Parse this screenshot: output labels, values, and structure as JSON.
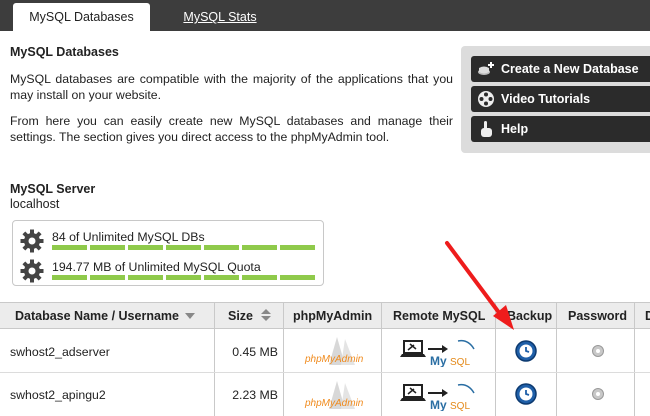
{
  "tabs": [
    {
      "label": "MySQL Databases",
      "active": true
    },
    {
      "label": "MySQL Stats",
      "active": false
    }
  ],
  "page": {
    "title": "MySQL Databases",
    "intro_1": "MySQL databases are compatible with the majority of the applications that you may install on your website.",
    "intro_2": "From here you can easily create new MySQL databases and manage their settings. The section gives you direct access to the phpMyAdmin tool."
  },
  "actions": {
    "create_label": "Create a New Database",
    "video_label": "Video Tutorials",
    "help_label": "Help"
  },
  "server": {
    "title": "MySQL Server",
    "host": "localhost"
  },
  "quota": {
    "dbs_text": "84 of Unlimited MySQL DBs",
    "size_text": "194.77 MB of Unlimited MySQL Quota"
  },
  "table": {
    "headers": {
      "name": "Database Name / Username",
      "size": "Size",
      "phpmyadmin": "phpMyAdmin",
      "remote": "Remote MySQL",
      "backup": "Backup",
      "password": "Password"
    },
    "rows": [
      {
        "name": "swhost2_adserver",
        "size": "0.45 MB",
        "phpmyadmin_logo": "phpMyAdmin"
      },
      {
        "name": "swhost2_apingu2",
        "size": "2.23 MB",
        "phpmyadmin_logo": "phpMyAdmin"
      }
    ]
  },
  "colors": {
    "tabbar": "#3d3d3d",
    "button": "#2b2b2b",
    "quota_bar": "#8fca4b",
    "annotation_arrow": "#ee1c1c",
    "backup_icon": "#1f5fa8"
  },
  "icons": {
    "create": "database-create-icon",
    "video": "film-reel-icon",
    "help": "pointing-hand-icon",
    "quota": "gear-icon",
    "remote": "laptop-to-mysql-icon",
    "backup": "backup-clock-icon",
    "password": "settings-gear-icon",
    "sort": "sort-arrow-icon"
  }
}
